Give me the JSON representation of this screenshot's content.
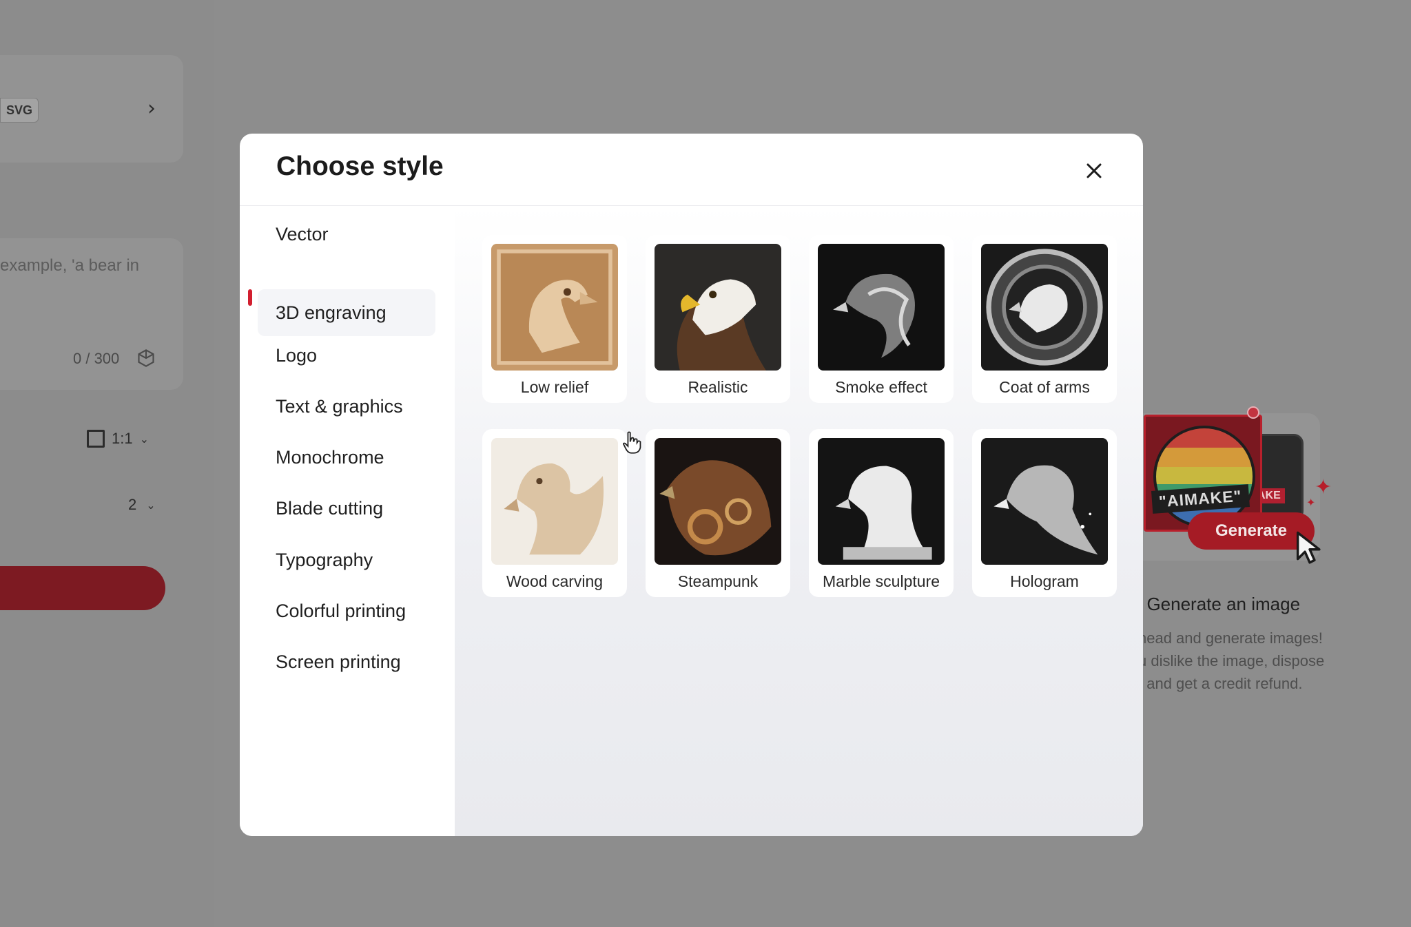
{
  "background": {
    "format_chip": "SVG",
    "prompt_placeholder": "example, 'a bear in",
    "char_count": "0 / 300",
    "aspect_ratio": "1:1",
    "image_count": "2",
    "promo": {
      "badge_text": "\"AIMAKE\"",
      "badge_text_2": "AKE",
      "generate_label": "Generate",
      "title": ". Generate an image",
      "desc_lines": [
        "head and generate images!",
        "u dislike the image, dispose",
        "t and get a credit refund."
      ]
    }
  },
  "modal": {
    "title": "Choose style",
    "close_icon": "close-icon",
    "nav_items": [
      {
        "label": "Vector"
      },
      {
        "label": "3D engraving"
      },
      {
        "label": "Logo"
      },
      {
        "label": "Text & graphics"
      },
      {
        "label": "Monochrome"
      },
      {
        "label": "Blade cutting"
      },
      {
        "label": "Typography"
      },
      {
        "label": "Colorful printing"
      },
      {
        "label": "Screen printing"
      }
    ],
    "active_nav": "3D engraving",
    "styles": [
      {
        "label": "Low relief"
      },
      {
        "label": "Realistic"
      },
      {
        "label": "Smoke effect"
      },
      {
        "label": "Coat of arms"
      },
      {
        "label": "Wood carving"
      },
      {
        "label": "Steampunk"
      },
      {
        "label": "Marble sculpture"
      },
      {
        "label": "Hologram"
      }
    ]
  },
  "colors": {
    "accent": "#d21f2f",
    "overlay": "#8a8a8a"
  }
}
